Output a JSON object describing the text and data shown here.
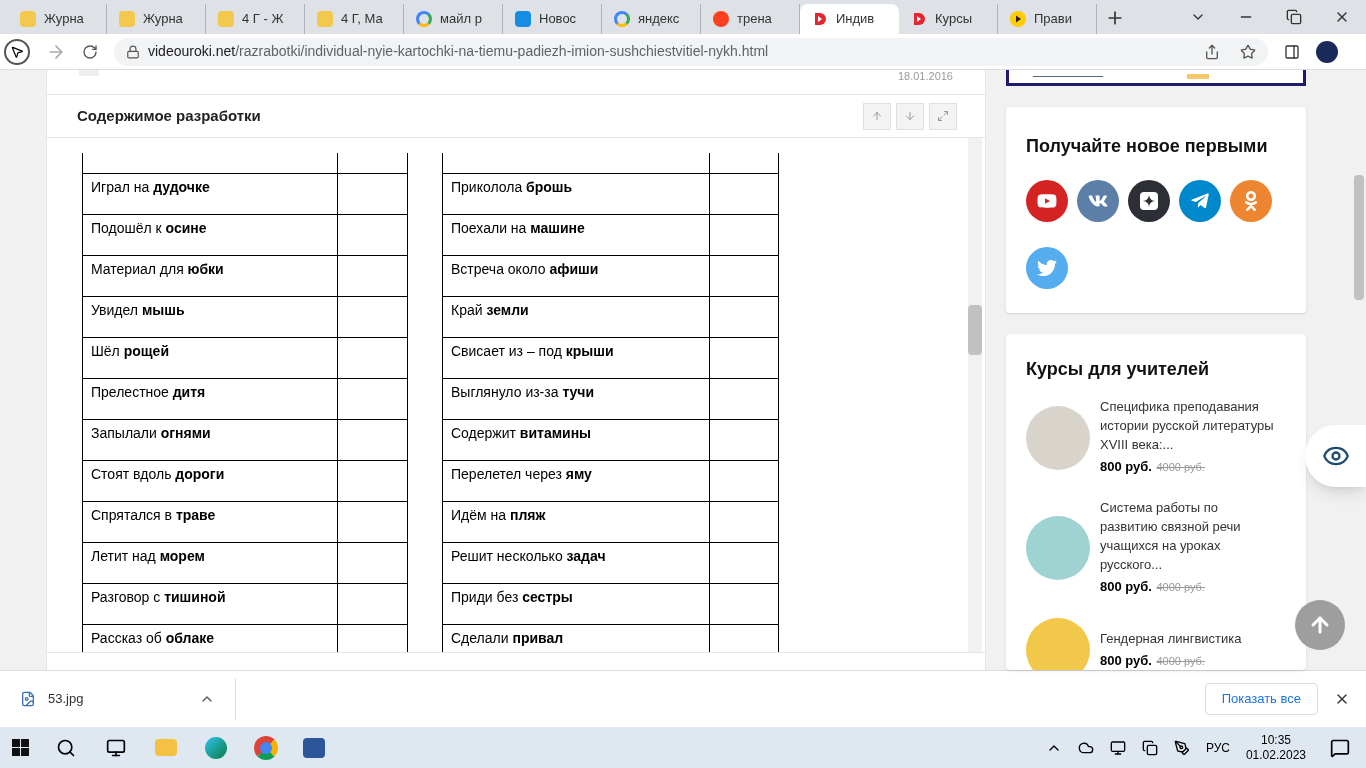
{
  "browser": {
    "tabs": [
      {
        "title": "Журна",
        "selected": false
      },
      {
        "title": "Журна",
        "selected": false
      },
      {
        "title": "4 Г - Ж",
        "selected": false
      },
      {
        "title": "4 Г, Ма",
        "selected": false
      },
      {
        "title": "майл р",
        "selected": false
      },
      {
        "title": "Новос",
        "selected": false
      },
      {
        "title": "яндекс",
        "selected": false
      },
      {
        "title": "трена",
        "selected": false
      },
      {
        "title": "Индив",
        "selected": true
      },
      {
        "title": "Курсы",
        "selected": false
      },
      {
        "title": "Прави",
        "selected": false
      }
    ],
    "url_host": "videouroki.net",
    "url_path": "/razrabotki/individual-nyie-kartochki-na-tiemu-padiezh-imion-sushchiestvitiel-nykh.html"
  },
  "content": {
    "date": "18.01.2016",
    "title": "Содержимое разработки",
    "rows": [
      {
        "left": "Играл на **дудочке**",
        "right": "Приколола **брошь**"
      },
      {
        "left": "Подошёл к **осине**",
        "right": "Поехали на **машине**"
      },
      {
        "left": "Материал для **юбки**",
        "right": "Встреча около **афиши**"
      },
      {
        "left": "Увидел **мышь**",
        "right": "Край **земли**"
      },
      {
        "left": "Шёл **рощей**",
        "right": "Свисает из – под **крыши**"
      },
      {
        "left": "Прелестное **дитя**",
        "right": "Выглянуло из-за **тучи**"
      },
      {
        "left": "Запылали **огнями**",
        "right": "Содержит **витамины**"
      },
      {
        "left": "Стоят вдоль **дороги**",
        "right": "Перелетел через **яму**"
      },
      {
        "left": "Спрятался в **траве**",
        "right": "Идём на **пляж**"
      },
      {
        "left": "Летит над **морем**",
        "right": "Решит несколько **задач**"
      },
      {
        "left": "Разговор с **тишиной**",
        "right": "Приди без **сестры**"
      },
      {
        "left": "Рассказ об **облаке**",
        "right": "Сделали **привал**"
      }
    ]
  },
  "sidebar": {
    "social_title": "Получайте новое первыми",
    "social": [
      {
        "kind": "youtube",
        "color": "#d32323"
      },
      {
        "kind": "vk",
        "color": "#5b7fa6"
      },
      {
        "kind": "zen",
        "color": "#2c2f36"
      },
      {
        "kind": "telegram",
        "color": "#0088cc"
      },
      {
        "kind": "ok",
        "color": "#ee8530"
      },
      {
        "kind": "twitter",
        "color": "#55acee"
      }
    ],
    "courses_title": "Курсы для учителей",
    "courses": [
      {
        "title": "Специфика преподавания истории русской литературы XVIII века:...",
        "price": "800 руб.",
        "old_price": "4000 руб."
      },
      {
        "title": "Система работы по развитию связной речи учащихся на уроках русского...",
        "price": "800 руб.",
        "old_price": "4000 руб."
      },
      {
        "title": "Гендерная лингвистика",
        "price": "800 руб.",
        "old_price": "4000 руб."
      }
    ]
  },
  "downloads": {
    "file": "53.jpg",
    "show_all": "Показать все"
  },
  "taskbar": {
    "lang": "РУС",
    "time": "10:35",
    "date": "01.02.2023"
  }
}
